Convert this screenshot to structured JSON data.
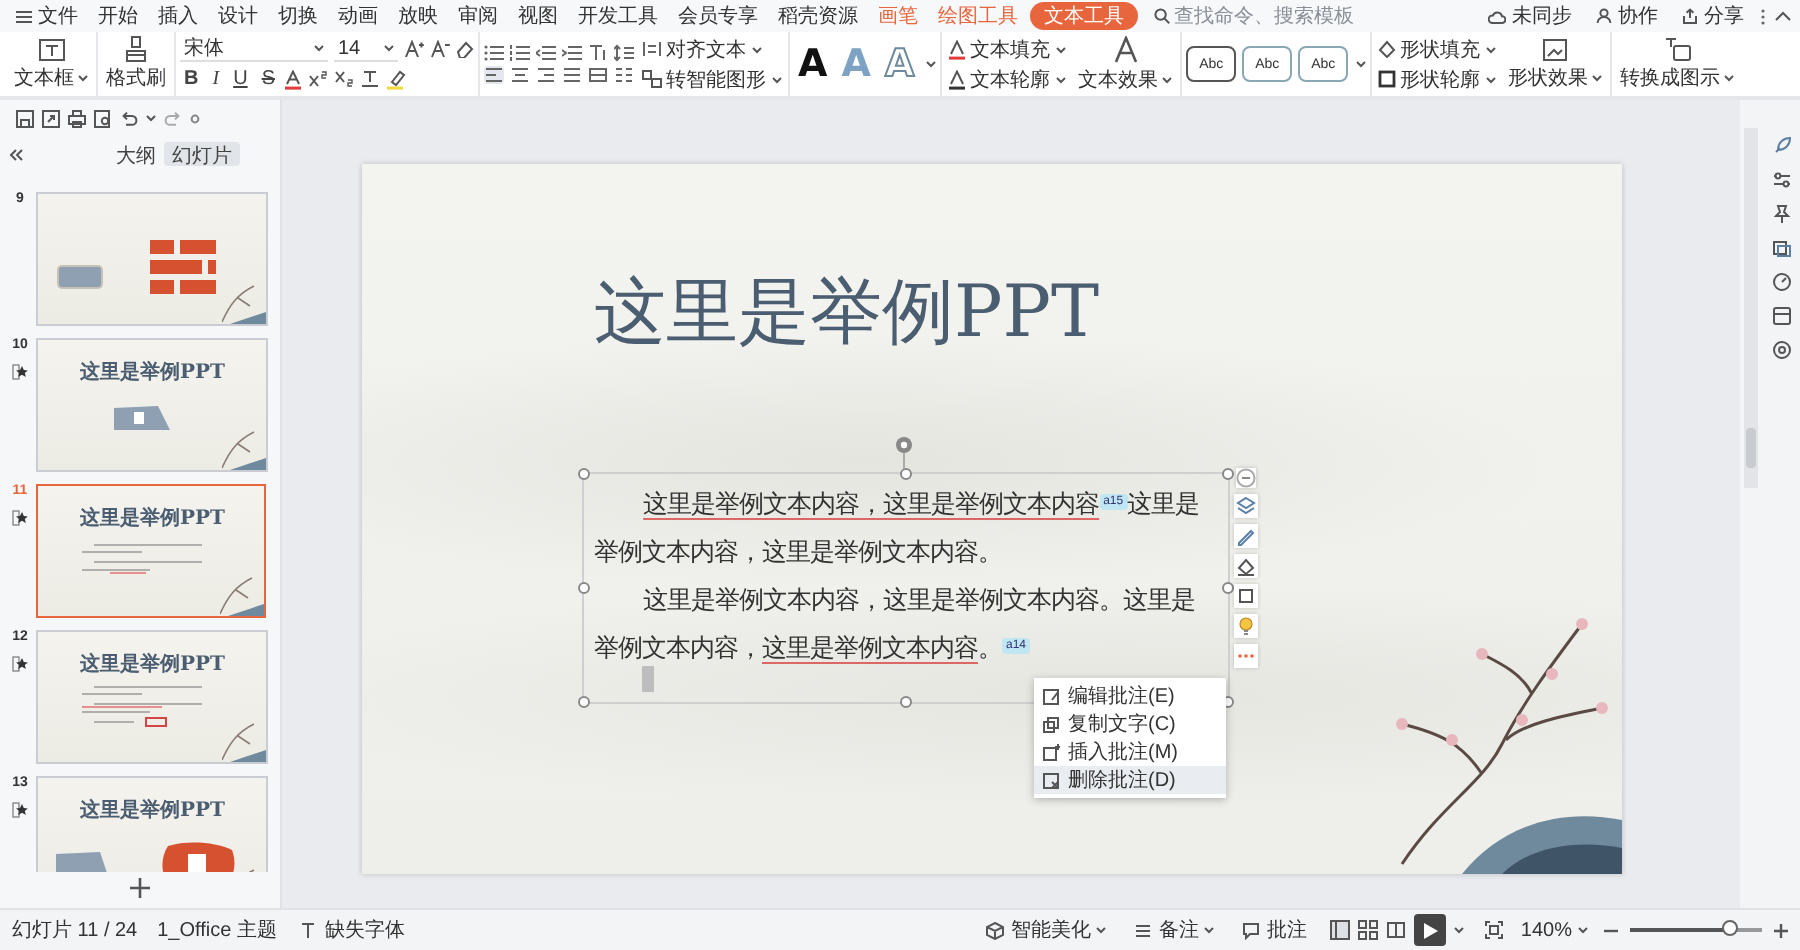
{
  "menu": {
    "tabs": [
      {
        "label": "文件",
        "kind": "file",
        "selected": false
      },
      {
        "label": "开始",
        "kind": "normal",
        "selected": false
      },
      {
        "label": "插入",
        "kind": "normal",
        "selected": false
      },
      {
        "label": "设计",
        "kind": "normal",
        "selected": false
      },
      {
        "label": "切换",
        "kind": "normal",
        "selected": false
      },
      {
        "label": "动画",
        "kind": "normal",
        "selected": false
      },
      {
        "label": "放映",
        "kind": "normal",
        "selected": false
      },
      {
        "label": "审阅",
        "kind": "normal",
        "selected": false
      },
      {
        "label": "视图",
        "kind": "normal",
        "selected": false
      },
      {
        "label": "开发工具",
        "kind": "normal",
        "selected": false
      },
      {
        "label": "会员专享",
        "kind": "normal",
        "selected": false
      },
      {
        "label": "稻壳资源",
        "kind": "normal",
        "selected": false
      },
      {
        "label": "画笔",
        "kind": "contextual",
        "selected": false
      },
      {
        "label": "绘图工具",
        "kind": "contextual",
        "selected": false
      },
      {
        "label": "文本工具",
        "kind": "contextual",
        "selected": true
      }
    ],
    "search": {
      "placeholder": "查找命令、搜索模板"
    },
    "actions": [
      {
        "label": "未同步",
        "kind": "cloud"
      },
      {
        "label": "协作",
        "kind": "people"
      },
      {
        "label": "分享",
        "kind": "share"
      }
    ]
  },
  "ribbon": {
    "text_box": "文本框",
    "format_painter": "格式刷",
    "font": "宋体",
    "size": "14",
    "format_buttons": [
      "B",
      "I",
      "U",
      "S"
    ],
    "align_text": "对齐文本",
    "smart_art": "转智能图形",
    "art_letters": [
      {
        "text": "A",
        "kind": "solid"
      },
      {
        "text": "A",
        "kind": "blue"
      },
      {
        "text": "A",
        "kind": "outline"
      }
    ],
    "text_fill": "文本填充",
    "text_outline": "文本轮廓",
    "text_effects": "文本效果",
    "style_samples": [
      {
        "text": "Abc",
        "kind": "dark"
      },
      {
        "text": "Abc",
        "kind": "light"
      },
      {
        "text": "Abc",
        "kind": "light"
      }
    ],
    "shape_fill": "形状填充",
    "shape_outline": "形状轮廓",
    "shape_effects": "形状效果",
    "convert": "转换成图示"
  },
  "sidebar": {
    "tabs": [
      {
        "label": "大纲",
        "selected": false
      },
      {
        "label": "幻灯片",
        "selected": true
      }
    ],
    "slides": [
      {
        "number": "9",
        "kind": "icons",
        "starred": false,
        "selected": false
      },
      {
        "number": "10",
        "kind": "picture",
        "title": "这里是举例PPT",
        "starred": true,
        "selected": false
      },
      {
        "number": "11",
        "kind": "text",
        "title": "这里是举例PPT",
        "starred": true,
        "selected": true
      },
      {
        "number": "12",
        "kind": "highlight",
        "title": "这里是举例PPT",
        "starred": true,
        "selected": false
      },
      {
        "number": "13",
        "kind": "logo",
        "title": "这里是举例PPT",
        "starred": true,
        "selected": false
      }
    ]
  },
  "slide": {
    "title": "这里是举例PPT",
    "paragraphs": [
      [
        {
          "kind": "text",
          "text": "这里是举例文本内容，这里是举例文本内容",
          "underline": true
        },
        {
          "kind": "comment",
          "text": "a15"
        },
        {
          "kind": "text",
          "text": "这里是举例文本内容，这里是举例文本内容。",
          "underline": false
        }
      ],
      [
        {
          "kind": "text",
          "text": "这里是举例文本内容，这里是举例文本内容。这里是举例文本内容，",
          "underline": false
        },
        {
          "kind": "text",
          "text": "这里是举例文本内容",
          "underline": true
        },
        {
          "kind": "text",
          "text": "。",
          "underline": false
        },
        {
          "kind": "comment",
          "text": "a14"
        }
      ]
    ],
    "context_menu": [
      {
        "label": "编辑批注(E)",
        "selected": false
      },
      {
        "label": "复制文字(C)",
        "selected": false
      },
      {
        "label": "插入批注(M)",
        "selected": false
      },
      {
        "label": "删除批注(D)",
        "selected": true
      }
    ]
  },
  "status_bar": {
    "slide_counter": "幻灯片 11 / 24",
    "theme": "1_Office 主题",
    "missing_font": "缺失字体",
    "beautify": "智能美化",
    "notes": "备注",
    "comments": "批注",
    "zoom": "140%",
    "zoom_slider": {
      "level": 0.75
    }
  }
}
